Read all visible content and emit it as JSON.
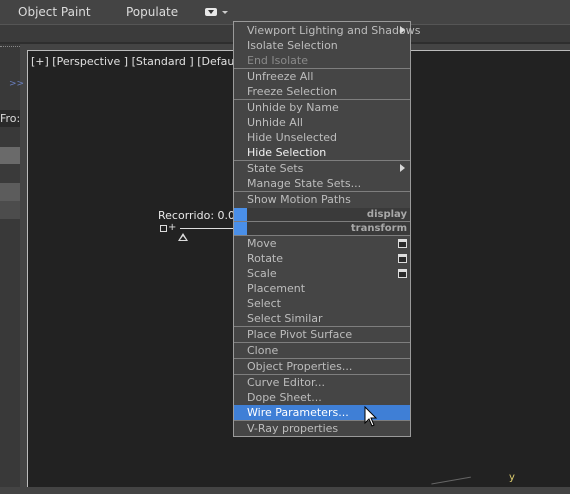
{
  "ribbon": {
    "tabs": [
      "Object Paint",
      "Populate"
    ]
  },
  "left_panel": {
    "arrows": ">>",
    "label": "Fro:"
  },
  "viewport": {
    "label": "[+] [Perspective ] [Standard ] [Default Sh",
    "recorrido": "Recorrido: 0.0",
    "axis_y": "y"
  },
  "context_menu": {
    "items": [
      {
        "label": "Viewport Lighting and Shadows",
        "state": "normal",
        "submenu": true
      },
      {
        "label": "Isolate Selection",
        "state": "normal"
      },
      {
        "label": "End Isolate",
        "state": "disabled"
      },
      {
        "label": "Unfreeze All",
        "state": "normal"
      },
      {
        "label": "Freeze Selection",
        "state": "normal"
      },
      {
        "label": "Unhide by Name",
        "state": "normal"
      },
      {
        "label": "Unhide All",
        "state": "normal"
      },
      {
        "label": "Hide Unselected",
        "state": "normal"
      },
      {
        "label": "Hide Selection",
        "state": "bright"
      },
      {
        "label": "State Sets",
        "state": "normal",
        "submenu": true
      },
      {
        "label": "Manage State Sets...",
        "state": "normal"
      },
      {
        "label": "Show Motion Paths",
        "state": "normal"
      },
      {
        "label": "Move",
        "state": "normal",
        "options": true
      },
      {
        "label": "Rotate",
        "state": "normal",
        "options": true
      },
      {
        "label": "Scale",
        "state": "normal",
        "options": true
      },
      {
        "label": "Placement",
        "state": "normal"
      },
      {
        "label": "Select",
        "state": "normal"
      },
      {
        "label": "Select Similar",
        "state": "normal"
      },
      {
        "label": "Place Pivot Surface",
        "state": "normal"
      },
      {
        "label": "Clone",
        "state": "normal"
      },
      {
        "label": "Object Properties...",
        "state": "normal"
      },
      {
        "label": "Curve Editor...",
        "state": "normal"
      },
      {
        "label": "Dope Sheet...",
        "state": "normal"
      },
      {
        "label": "Wire Parameters...",
        "state": "highlighted"
      },
      {
        "label": "V-Ray properties",
        "state": "normal"
      }
    ],
    "quad_labels": [
      "display",
      "transform"
    ]
  },
  "colors": {
    "highlight": "#3f7fd6",
    "quad_marker": "#4a8fe8",
    "menu_bg": "#454545",
    "viewport_bg": "#222222"
  },
  "icons": [
    "dropdown-icon",
    "submenu-arrow-icon",
    "options-box-icon",
    "mouse-cursor-icon"
  ]
}
